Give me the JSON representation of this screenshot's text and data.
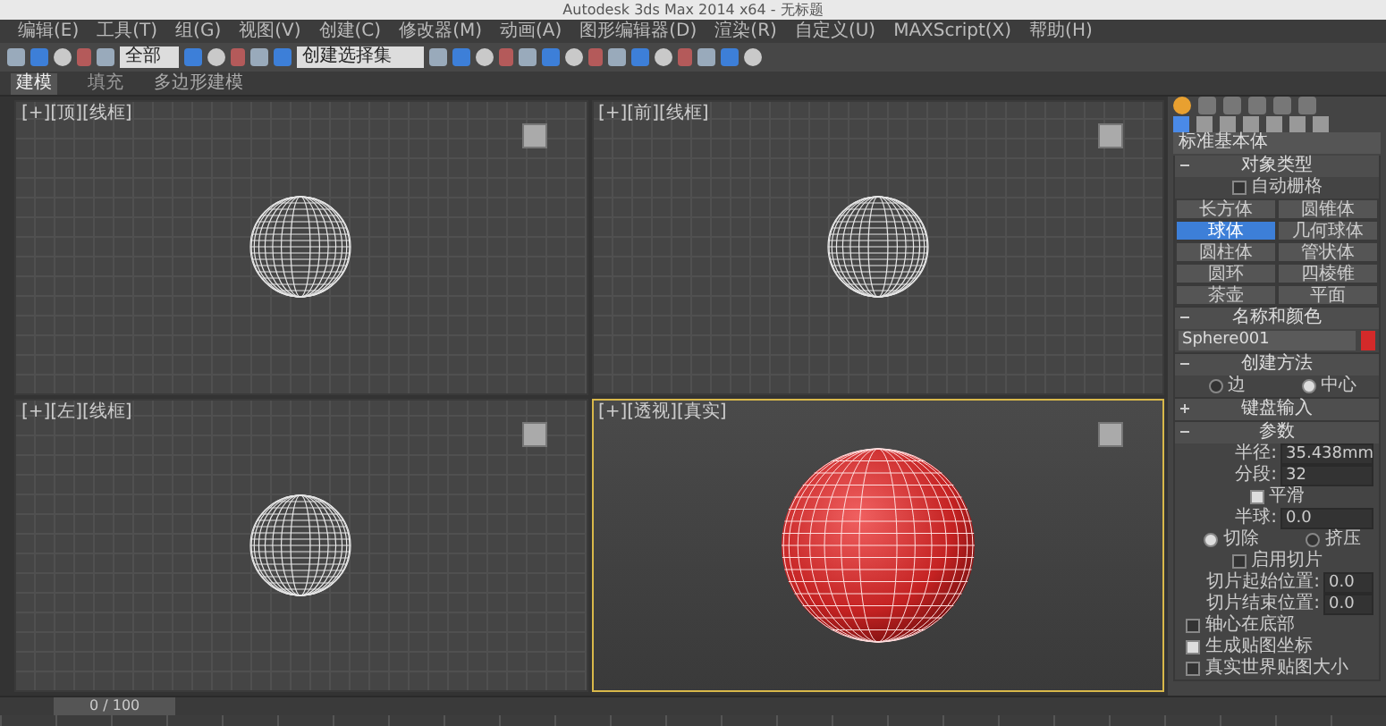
{
  "window": {
    "title": "Autodesk 3ds Max 2014 x64 - 无标题"
  },
  "menu": [
    "编辑(E)",
    "工具(T)",
    "组(G)",
    "视图(V)",
    "创建(C)",
    "修改器(M)",
    "动画(A)",
    "图形编辑器(D)",
    "渲染(R)",
    "自定义(U)",
    "MAXScript(X)",
    "帮助(H)"
  ],
  "toolbar": {
    "selection_filter": "全部",
    "named_selection": "创建选择集"
  },
  "ribbon": {
    "tabs": [
      {
        "label": "建模",
        "selected": true
      },
      {
        "label": "填充",
        "selected": false
      }
    ],
    "subtitle": "多边形建模"
  },
  "viewports": [
    {
      "label": "[+][顶][线框]",
      "active": false,
      "kind": "wireframe"
    },
    {
      "label": "[+][前][线框]",
      "active": false,
      "kind": "wireframe"
    },
    {
      "label": "[+][左][线框]",
      "active": false,
      "kind": "wireframe"
    },
    {
      "label": "[+][透视][真实]",
      "active": true,
      "kind": "shaded"
    }
  ],
  "command_panel": {
    "tabs": [
      {
        "selected": true
      },
      {
        "selected": false
      },
      {
        "selected": false
      },
      {
        "selected": false
      },
      {
        "selected": false
      },
      {
        "selected": false
      }
    ],
    "categories": [
      {
        "selected": true
      },
      {
        "selected": false
      },
      {
        "selected": false
      },
      {
        "selected": false
      },
      {
        "selected": false
      },
      {
        "selected": false
      },
      {
        "selected": false
      }
    ],
    "dropdown": "标准基本体",
    "object_type": {
      "title": "对象类型",
      "expanded": true,
      "autogrid": {
        "label": "自动栅格",
        "checked": false
      },
      "buttons": [
        {
          "label": "长方体",
          "selected": false
        },
        {
          "label": "圆锥体",
          "selected": false
        },
        {
          "label": "球体",
          "selected": true
        },
        {
          "label": "几何球体",
          "selected": false
        },
        {
          "label": "圆柱体",
          "selected": false
        },
        {
          "label": "管状体",
          "selected": false
        },
        {
          "label": "圆环",
          "selected": false
        },
        {
          "label": "四棱锥",
          "selected": false
        },
        {
          "label": "茶壶",
          "selected": false
        },
        {
          "label": "平面",
          "selected": false
        }
      ]
    },
    "name_color": {
      "title": "名称和颜色",
      "expanded": true,
      "name": "Sphere001",
      "color": "#d42a2a"
    },
    "creation_method": {
      "title": "创建方法",
      "expanded": true,
      "options": [
        {
          "label": "边",
          "selected": false
        },
        {
          "label": "中心",
          "selected": true
        }
      ]
    },
    "keyboard_entry": {
      "title": "键盘输入",
      "expanded": false
    },
    "parameters": {
      "title": "参数",
      "expanded": true,
      "fields": [
        {
          "label": "半径:",
          "value": "35.438mm"
        },
        {
          "label": "分段:",
          "value": "32"
        }
      ],
      "smooth": {
        "label": "平滑",
        "checked": true
      },
      "hemisphere": {
        "label": "半球:",
        "value": "0.0"
      },
      "modes": [
        {
          "label": "切除",
          "selected": true
        },
        {
          "label": "挤压",
          "selected": false
        }
      ],
      "slice": {
        "label": "启用切片",
        "checked": false
      },
      "slice_fields": [
        {
          "label": "切片起始位置:",
          "value": "0.0"
        },
        {
          "label": "切片结束位置:",
          "value": "0.0"
        }
      ],
      "options": [
        {
          "label": "轴心在底部",
          "checked": false
        },
        {
          "label": "生成贴图坐标",
          "checked": true
        },
        {
          "label": "真实世界贴图大小",
          "checked": false
        }
      ]
    }
  },
  "timeline": {
    "frame": "0 / 100",
    "level": 0
  }
}
